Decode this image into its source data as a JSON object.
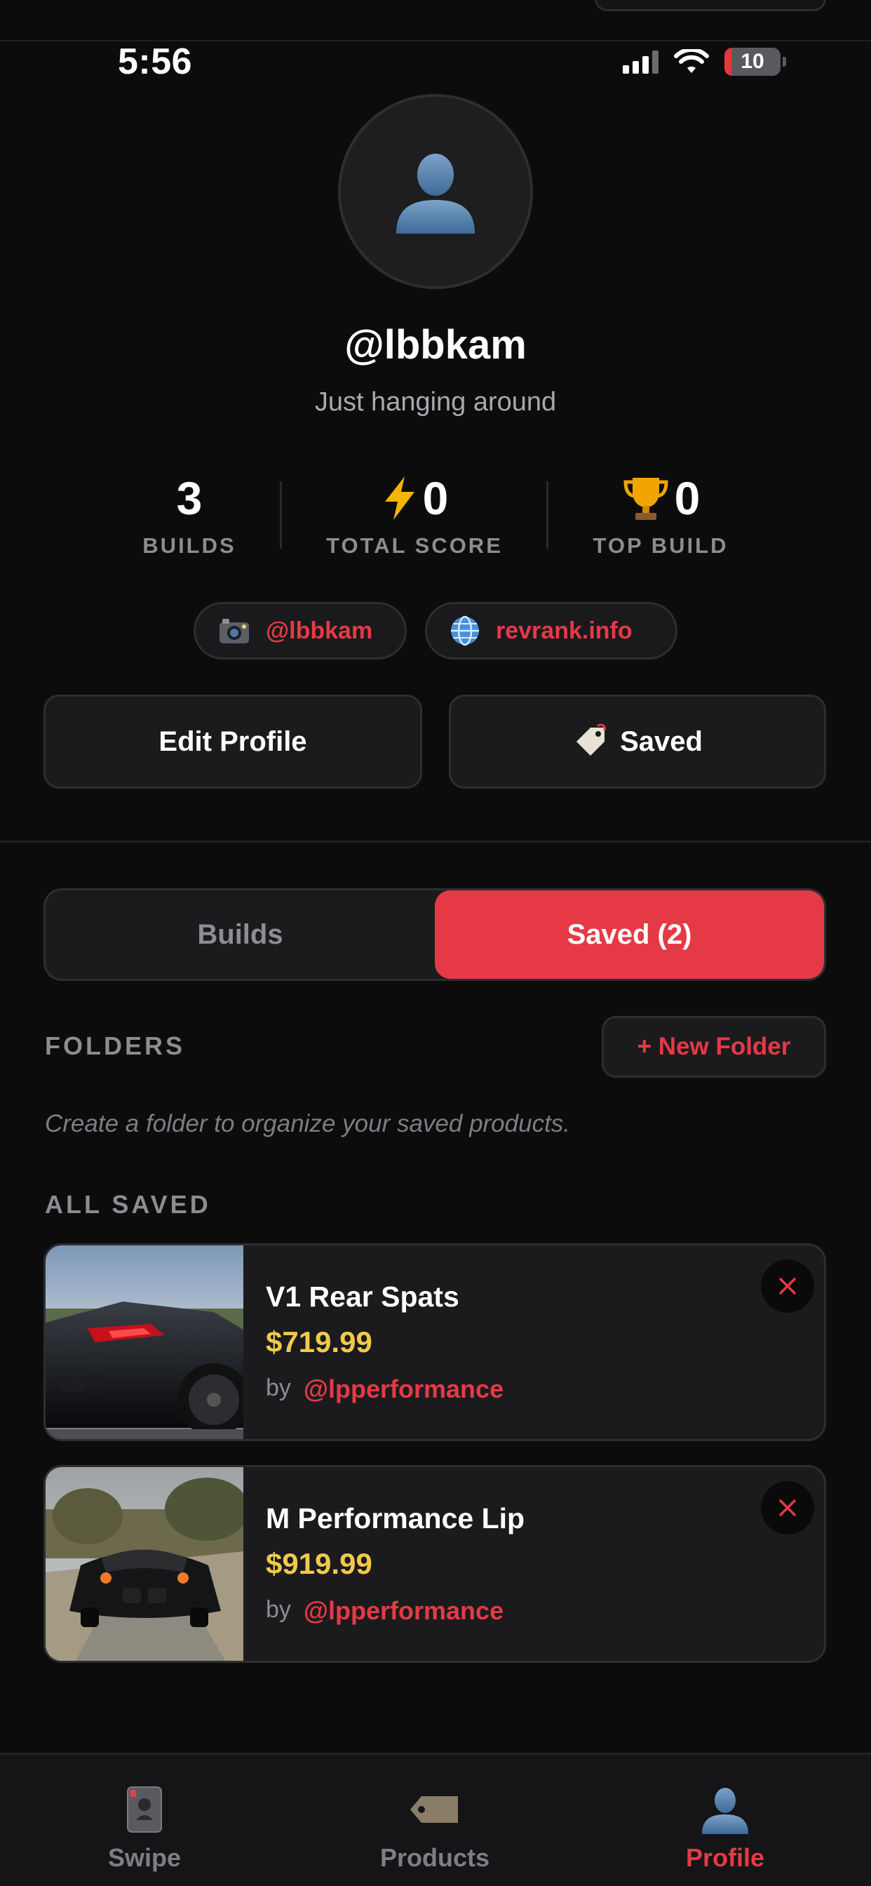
{
  "status_bar": {
    "time": "5:56",
    "battery": "10"
  },
  "profile": {
    "username": "@lbbkam",
    "bio": "Just hanging around"
  },
  "stats": [
    {
      "value": "3",
      "label": "BUILDS",
      "icon": ""
    },
    {
      "value": "0",
      "label": "TOTAL SCORE",
      "icon": "lightning-icon"
    },
    {
      "value": "0",
      "label": "TOP BUILD",
      "icon": "trophy-icon"
    }
  ],
  "links": {
    "instagram": {
      "label": "@lbbkam",
      "icon": "camera-icon"
    },
    "website": {
      "label": "revrank.info",
      "icon": "globe-icon"
    }
  },
  "actions": {
    "edit_profile": "Edit Profile",
    "saved": "Saved"
  },
  "tabs": {
    "builds": "Builds",
    "saved": "Saved (2)",
    "active": "saved"
  },
  "folders": {
    "title": "FOLDERS",
    "new_folder": "+ New Folder",
    "hint": "Create a folder to organize your saved products."
  },
  "all_saved": {
    "title": "ALL SAVED",
    "items": [
      {
        "name": "V1 Rear Spats",
        "price": "$719.99",
        "by": "by",
        "seller": "@lpperformance"
      },
      {
        "name": "M Performance Lip",
        "price": "$919.99",
        "by": "by",
        "seller": "@lpperformance"
      }
    ]
  },
  "tabbar": {
    "items": [
      {
        "label": "Swipe",
        "icon": "card-icon"
      },
      {
        "label": "Products",
        "icon": "tag-icon"
      },
      {
        "label": "Profile",
        "icon": "user-icon"
      }
    ],
    "active": "Profile"
  },
  "colors": {
    "accent": "#e63946",
    "price": "#f2c94c",
    "background": "#0c0c0d",
    "card": "#1b1b1d"
  }
}
